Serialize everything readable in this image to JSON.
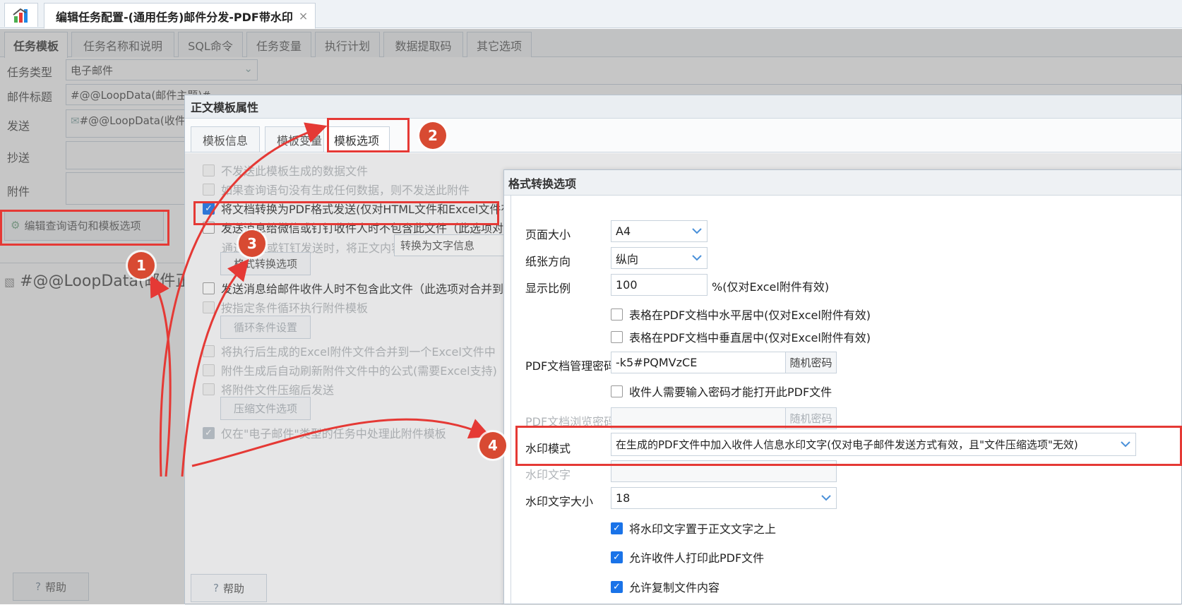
{
  "top_tab": {
    "title": "编辑任务配置-(通用任务)邮件分发-PDF带水印",
    "close": "×"
  },
  "main": {
    "tabs": [
      "任务模板",
      "任务名称和说明",
      "SQL命令",
      "任务变量",
      "执行计划",
      "数据提取码",
      "其它选项"
    ],
    "task_type_label": "任务类型",
    "task_type_value": "电子邮件",
    "subject_label": "邮件标题",
    "subject_value": "#@@LoopData(邮件主题)#",
    "send_label": "发送",
    "send_value": "#@@LoopData(收件",
    "cc_label": "抄送",
    "attach_label": "附件",
    "edit_query_button": "编辑查询语句和模板选项",
    "body_preview": "#@@LoopData(邮件正",
    "help_button": "帮助"
  },
  "dialog1": {
    "title": "正文模板属性",
    "tabs": [
      "模板信息",
      "模板变量",
      "模板选项"
    ],
    "options": [
      {
        "label": "不发送此模板生成的数据文件",
        "checked": false,
        "disabled": true
      },
      {
        "label": "如果查询语句没有生成任何数据，则不发送此附件",
        "checked": false,
        "disabled": true
      },
      {
        "label": "将文档转换为PDF格式发送(仅对HTML文件和Excel文件有",
        "checked": true,
        "disabled": false
      },
      {
        "label": "发送消息给微信或钉钉收件人时不包含此文件（此选项对",
        "checked": false,
        "disabled": false
      }
    ],
    "wechat_hint": "通过微信或钉钉发送时，将正文内容",
    "wechat_select": "转换为文字信息",
    "format_button": "格式转换选项",
    "options2": [
      {
        "label": "发送消息给邮件收件人时不包含此文件（此选项对合并到",
        "checked": false,
        "disabled": false
      },
      {
        "label": "按指定条件循环执行附件模板",
        "checked": false,
        "disabled": true
      }
    ],
    "loop_button": "循环条件设置",
    "options3": [
      {
        "label": "将执行后生成的Excel附件文件合并到一个Excel文件中",
        "checked": false,
        "disabled": true
      },
      {
        "label": "附件生成后自动刷新附件文件中的公式(需要Excel支持)",
        "checked": false,
        "disabled": true
      },
      {
        "label": "将附件文件压缩后发送",
        "checked": false,
        "disabled": true
      }
    ],
    "zip_button": "压缩文件选项",
    "only_email": {
      "label": "仅在\"电子邮件\"类型的任务中处理此附件模板",
      "checked": true,
      "disabled": true
    },
    "help_button": "帮助"
  },
  "dialog2": {
    "title": "格式转换选项",
    "page_size_label": "页面大小",
    "page_size_value": "A4",
    "orientation_label": "纸张方向",
    "orientation_value": "纵向",
    "scale_label": "显示比例",
    "scale_value": "100",
    "scale_hint": "%(仅对Excel附件有效)",
    "center_h": "表格在PDF文档中水平居中(仅对Excel附件有效)",
    "center_v": "表格在PDF文档中垂直居中(仅对Excel附件有效)",
    "admin_pw_label": "PDF文档管理密码",
    "admin_pw_value": "-k5#PQMVzCE",
    "random_button": "随机密码",
    "require_pw": "收件人需要输入密码才能打开此PDF文件",
    "view_pw_label": "PDF文档浏览密码",
    "view_pw_value": "",
    "random_button2": "随机密码",
    "watermark_mode_label": "水印模式",
    "watermark_mode_value": "在生成的PDF文件中加入收件人信息水印文字(仅对电子邮件发送方式有效，且\"文件压缩选项\"无效)",
    "watermark_text_label": "水印文字",
    "watermark_text_value": "",
    "watermark_size_label": "水印文字大小",
    "watermark_size_value": "18",
    "above_text": "将水印文字置于正文文字之上",
    "allow_print": "允许收件人打印此PDF文件",
    "allow_copy": "允许复制文件内容"
  },
  "annotations": [
    "1",
    "2",
    "3",
    "4"
  ],
  "colors": {
    "annotation_red": "#e53935",
    "badge": "#d84a32",
    "checkbox_blue": "#1a73e8"
  }
}
